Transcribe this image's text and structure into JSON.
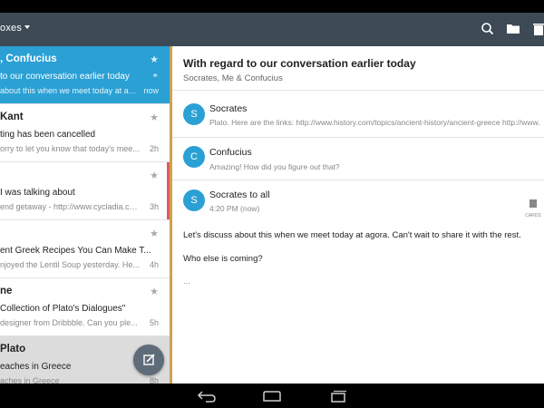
{
  "appbar": {
    "title": "oxes"
  },
  "message_list": [
    {
      "from": ", Confucius",
      "subject": "to our conversation earlier today",
      "preview": "about this when we meet today at ago...",
      "time": "now",
      "state": "active",
      "bar_color": "#2aa0d4"
    },
    {
      "from": "Kant",
      "subject": "ting has been cancelled",
      "preview": "orry to let you know that today's mee...",
      "time": "2h",
      "state": "normal",
      "bar_color": "#ffffff"
    },
    {
      "from": "",
      "subject": "I was talking about",
      "preview": "end getaway - http://www.cycladia.co...",
      "time": "3h",
      "state": "normal",
      "bar_color": "#e05c5c"
    },
    {
      "from": "",
      "subject": "ent Greek Recipes You Can Make T...",
      "preview": "njoyed the Lentil Soup yesterday. He...",
      "time": "4h",
      "state": "normal",
      "bar_color": "#d2a14b"
    },
    {
      "from": "ne",
      "subject": "Collection of Plato's Dialogues\"",
      "preview": "designer from Dribbble. Can you ple...",
      "time": "5h",
      "state": "normal",
      "bar_color": "#d2a14b"
    },
    {
      "from": "Plato",
      "subject": "eaches in Greece",
      "preview": "aches in Greece",
      "time": "8h",
      "state": "grey",
      "bar_color": "#d2a14b"
    }
  ],
  "thread": {
    "title": "With regard to our conversation earlier today",
    "participants": "Socrates, Me & Confucius",
    "messages": [
      {
        "initial": "S",
        "sender": "Socrates",
        "snippet": "Plato. Here are the links: http://www.history.com/topics/ancient-history/ancient-greece http://www."
      },
      {
        "initial": "C",
        "sender": "Confucius",
        "snippet": "Amazing! How did you figure out that?"
      }
    ],
    "expanded": {
      "initial": "S",
      "sender": "Socrates to all",
      "time": "4:20 PM (now)",
      "body_line1": "Let's discuss about this when we meet today at agora. Can't wait to share it with the rest.",
      "body_line2": "Who else is coming?",
      "ellipsis": "...",
      "cards_label": "CARDS"
    }
  },
  "icons": {
    "search": "search-icon",
    "folder": "folder-icon",
    "trash": "trash-icon",
    "star": "star-icon",
    "attachment": "paperclip-icon",
    "compose": "compose-icon",
    "back": "back-icon",
    "home": "home-icon",
    "recents": "recents-icon"
  },
  "colors": {
    "accent": "#2aa0d4",
    "appbar": "#3d4a55",
    "fab": "#5d6c78"
  }
}
